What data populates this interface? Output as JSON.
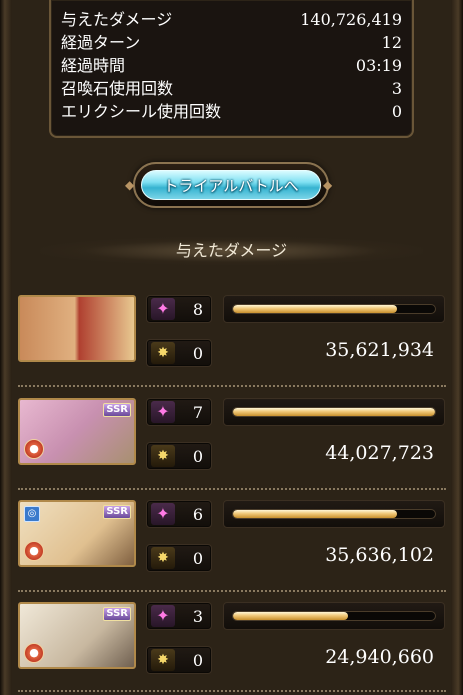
{
  "summary": {
    "rows": [
      {
        "label": "与えたダメージ",
        "value": "140,726,419"
      },
      {
        "label": "経過ターン",
        "value": "12"
      },
      {
        "label": "経過時間",
        "value": "03:19"
      },
      {
        "label": "召喚石使用回数",
        "value": "3"
      },
      {
        "label": "エリクシール使用回数",
        "value": "0"
      }
    ]
  },
  "trial_button": {
    "label": "トライアルバトルへ"
  },
  "section": {
    "title": "与えたダメージ"
  },
  "characters": [
    {
      "skill_count": "8",
      "ca_count": "0",
      "damage": "35,621,934",
      "damage_fraction": 0.81,
      "ssr": "",
      "has_element": false,
      "has_ring": false
    },
    {
      "skill_count": "7",
      "ca_count": "0",
      "damage": "44,027,723",
      "damage_fraction": 1.0,
      "ssr": "SSR",
      "has_element": true,
      "has_ring": false
    },
    {
      "skill_count": "6",
      "ca_count": "0",
      "damage": "35,636,102",
      "damage_fraction": 0.81,
      "ssr": "SSR",
      "has_element": true,
      "has_ring": true
    },
    {
      "skill_count": "3",
      "ca_count": "0",
      "damage": "24,940,660",
      "damage_fraction": 0.57,
      "ssr": "SSR",
      "has_element": true,
      "has_ring": false
    }
  ],
  "icons": {
    "skill": "skill-sparkle-icon",
    "ca": "charge-attack-icon",
    "element": "fire-element-icon",
    "ring": "ring-icon"
  },
  "colors": {
    "bar_fill": "#f0c878",
    "trial_button": "#7fe0f2"
  }
}
